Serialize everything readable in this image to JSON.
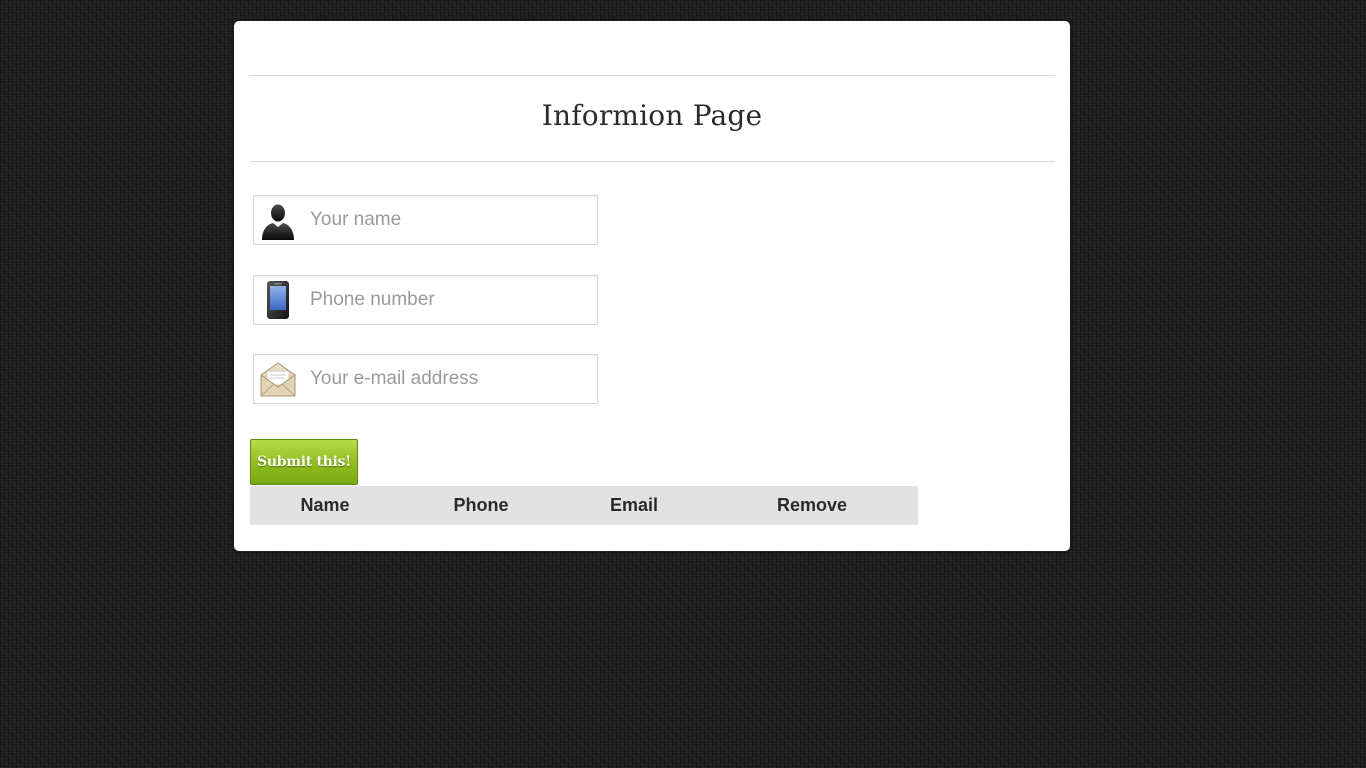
{
  "page": {
    "title": "Informion Page"
  },
  "form": {
    "name_field": {
      "placeholder": "Your name",
      "value": "",
      "icon": "user-silhouette-icon"
    },
    "phone_field": {
      "placeholder": "Phone number",
      "value": "",
      "icon": "mobile-phone-icon"
    },
    "email_field": {
      "placeholder": "Your e-mail address",
      "value": "",
      "icon": "envelope-icon"
    },
    "submit_label": "Submit this!"
  },
  "table": {
    "headers": [
      "Name",
      "Phone",
      "Email",
      "Remove"
    ],
    "rows": []
  },
  "colors": {
    "submit_green": "#8fbd1c",
    "table_header_bg": "#e2e2e2",
    "background": "#1e1e1e"
  }
}
